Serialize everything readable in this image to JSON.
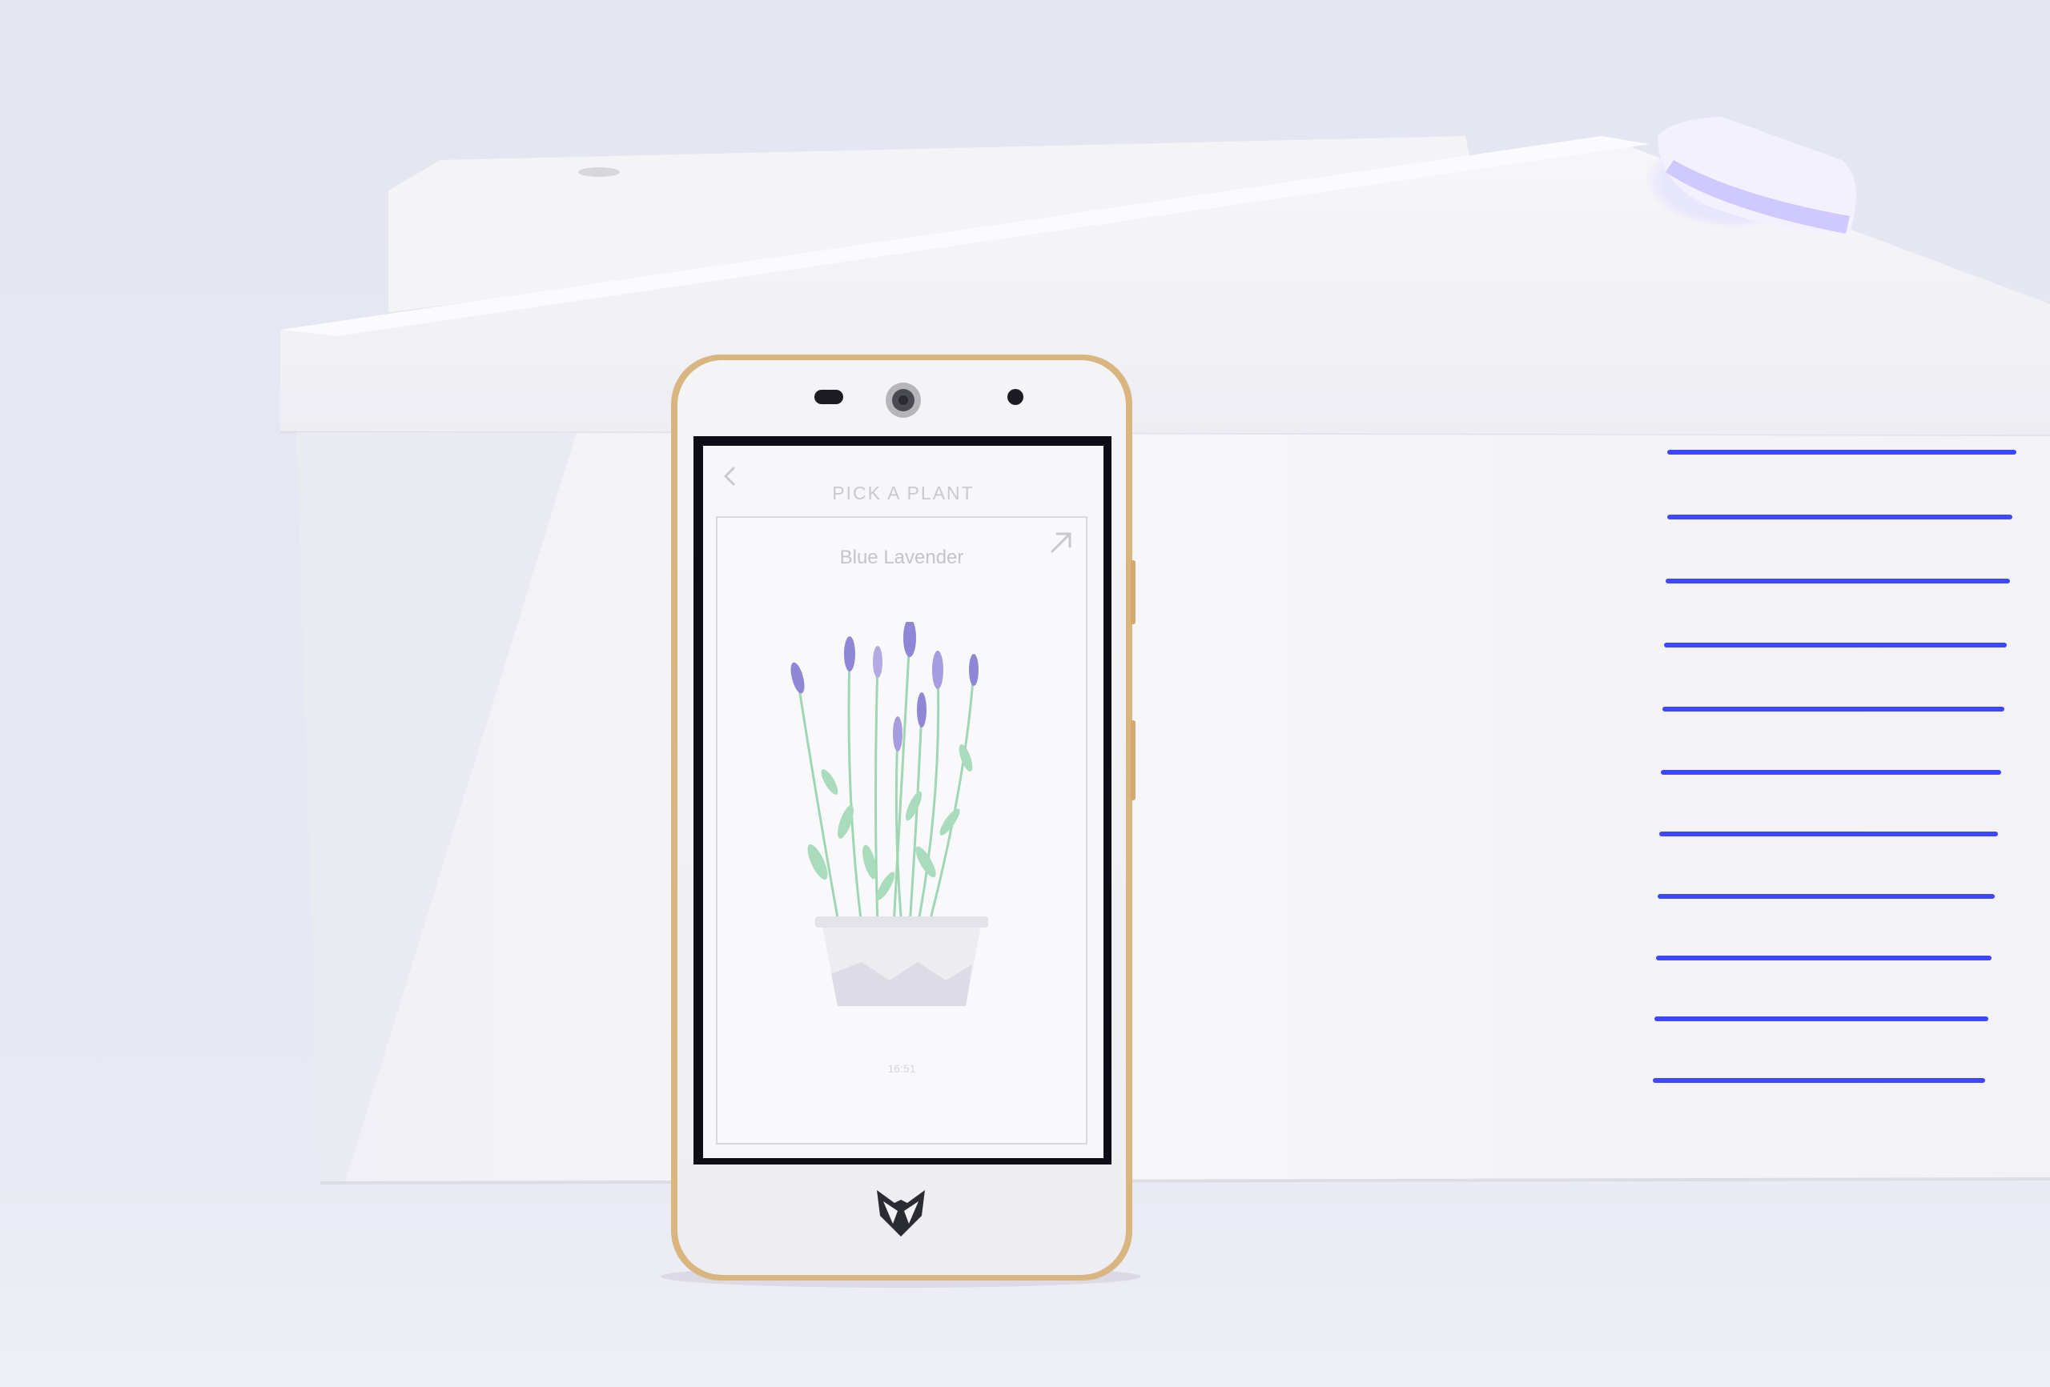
{
  "screen": {
    "title": "PICK A PLANT",
    "back_icon": "chevron-left-icon",
    "open_icon": "arrow-up-right-icon"
  },
  "plant": {
    "name": "Blue Lavender",
    "time": "16:51"
  },
  "colors": {
    "led_blue": "#3d47ff",
    "lavender": "#8f86d6",
    "stem_green": "#9fd6b4",
    "device_white": "#f3f3f6",
    "phone_gold": "#d8b27a"
  }
}
